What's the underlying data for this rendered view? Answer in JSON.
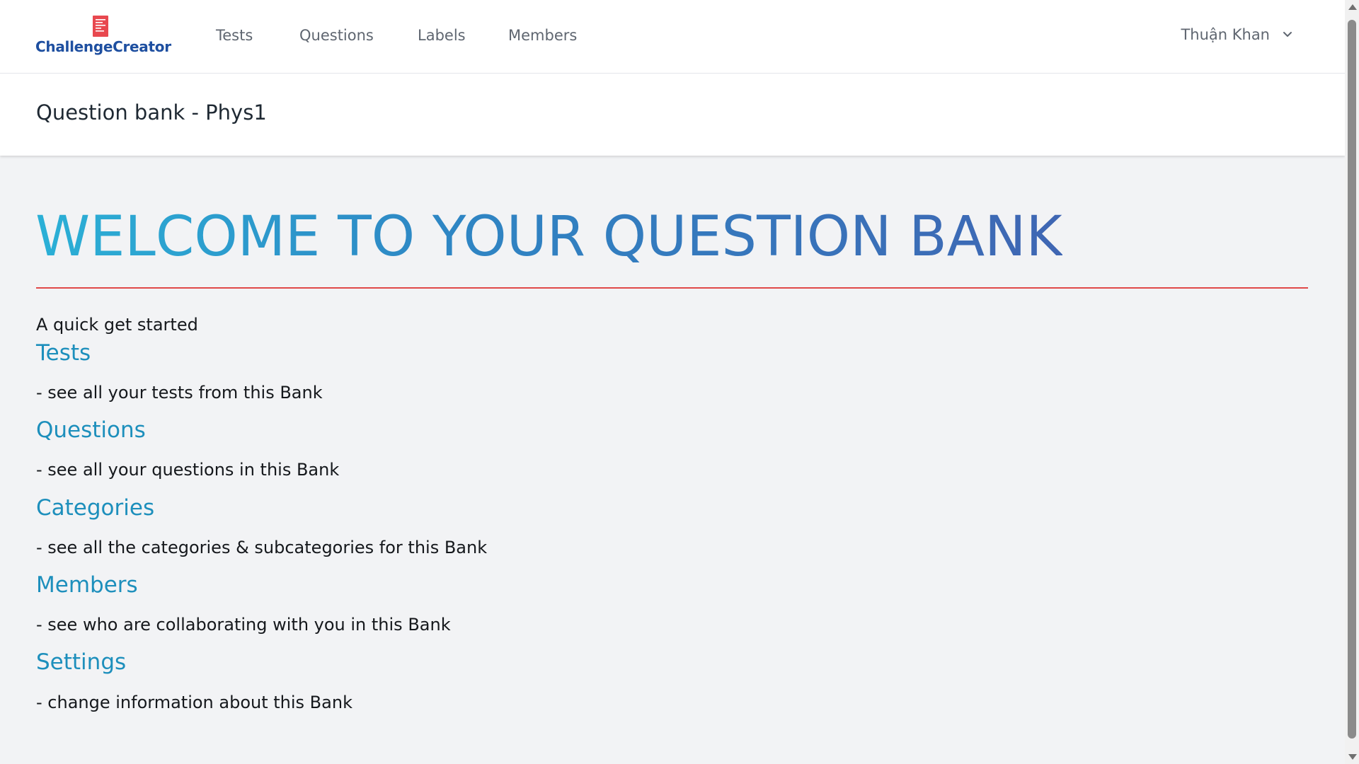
{
  "app": {
    "logo_text": "ChallengeCreator"
  },
  "nav": {
    "items": [
      {
        "label": "Tests"
      },
      {
        "label": "Questions"
      },
      {
        "label": "Labels"
      },
      {
        "label": "Members"
      }
    ],
    "user_name": "Thuận Khan"
  },
  "header": {
    "title": "Question bank - Phys1"
  },
  "main": {
    "hero": "WELCOME TO YOUR QUESTION BANK",
    "intro": "A quick get started",
    "sections": [
      {
        "title": "Tests",
        "desc": "- see all your tests from this Bank"
      },
      {
        "title": "Questions",
        "desc": "- see all your questions in this Bank"
      },
      {
        "title": "Categories",
        "desc": "- see all the categories & subcategories for this Bank"
      },
      {
        "title": "Members",
        "desc": "- see who are collaborating with you in this Bank"
      },
      {
        "title": "Settings",
        "desc": "- change information about this Bank"
      }
    ]
  },
  "colors": {
    "brand": "#1e4fa0",
    "logo_mark": "#e8484f",
    "accent_link": "#1d8fbc",
    "divider": "#e04848"
  }
}
